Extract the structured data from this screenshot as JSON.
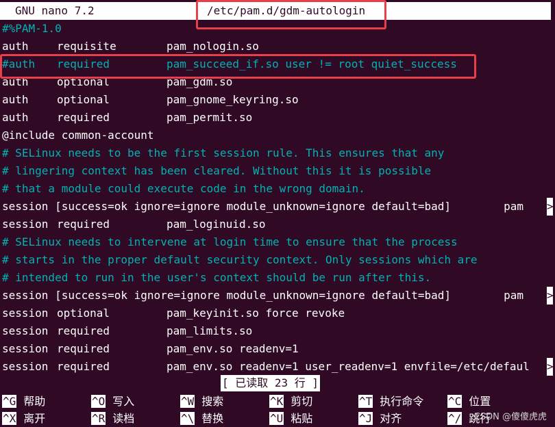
{
  "titlebar": {
    "app": "GNU nano 7.2",
    "file": "/etc/pam.d/gdm-autologin"
  },
  "lines": [
    {
      "type": "comment",
      "c1": "#%PAM-1.0"
    },
    {
      "type": "code",
      "c1": "auth",
      "c2": "requisite",
      "c3": "pam_nologin.so"
    },
    {
      "type": "comment",
      "c1": "#auth",
      "c2": "required",
      "c3": "pam_succeed_if.so user != root quiet_success"
    },
    {
      "type": "code",
      "c1": "auth",
      "c2": "optional",
      "c3": "pam_gdm.so"
    },
    {
      "type": "code",
      "c1": "auth",
      "c2": "optional",
      "c3": "pam_gnome_keyring.so"
    },
    {
      "type": "code",
      "c1": "auth",
      "c2": "required",
      "c3": "pam_permit.so"
    },
    {
      "type": "code",
      "c1": "@include common-account"
    },
    {
      "type": "comment",
      "c1": "# SELinux needs to be the first session rule. This ensures that any"
    },
    {
      "type": "comment",
      "c1": "# lingering context has been cleared. Without this it is possible"
    },
    {
      "type": "comment",
      "c1": "# that a module could execute code in the wrong domain."
    },
    {
      "type": "code",
      "c1": "session [success=ok ignore=ignore module_unknown=ignore default=bad]        pam",
      "more": true
    },
    {
      "type": "code",
      "c1": "session",
      "c2": "required",
      "c3": "pam_loginuid.so"
    },
    {
      "type": "comment",
      "c1": "# SELinux needs to intervene at login time to ensure that the process"
    },
    {
      "type": "comment",
      "c1": "# starts in the proper default security context. Only sessions which are"
    },
    {
      "type": "comment",
      "c1": "# intended to run in the user's context should be run after this."
    },
    {
      "type": "code",
      "c1": "session [success=ok ignore=ignore module_unknown=ignore default=bad]        pam",
      "more": true
    },
    {
      "type": "code",
      "c1": "session",
      "c2": "optional",
      "c3": "pam_keyinit.so force revoke"
    },
    {
      "type": "code",
      "c1": "session",
      "c2": "required",
      "c3": "pam_limits.so"
    },
    {
      "type": "code",
      "c1": "session",
      "c2": "required",
      "c3": "pam_env.so readenv=1"
    },
    {
      "type": "code",
      "c1": "session",
      "c2": "required",
      "c3": "pam_env.so readenv=1 user_readenv=1 envfile=/etc/defaul",
      "more": true
    }
  ],
  "more_marker": ">",
  "status": "[ 已读取 23 行 ]",
  "shortcuts": [
    {
      "key": "^G",
      "label": "帮助"
    },
    {
      "key": "^O",
      "label": "写入"
    },
    {
      "key": "^W",
      "label": "搜索"
    },
    {
      "key": "^K",
      "label": "剪切"
    },
    {
      "key": "^T",
      "label": "执行命令"
    },
    {
      "key": "^C",
      "label": "位置"
    },
    {
      "key": "^X",
      "label": "离开"
    },
    {
      "key": "^R",
      "label": "读档"
    },
    {
      "key": "^\\",
      "label": "替换"
    },
    {
      "key": "^U",
      "label": "粘贴"
    },
    {
      "key": "^J",
      "label": "对齐"
    },
    {
      "key": "^/",
      "label": "跳行"
    }
  ],
  "watermark": "CSDN @傻傻虎虎",
  "colors": {
    "background": "#300a24",
    "comment": "#00b3b3",
    "highlight": "#e8404a"
  }
}
